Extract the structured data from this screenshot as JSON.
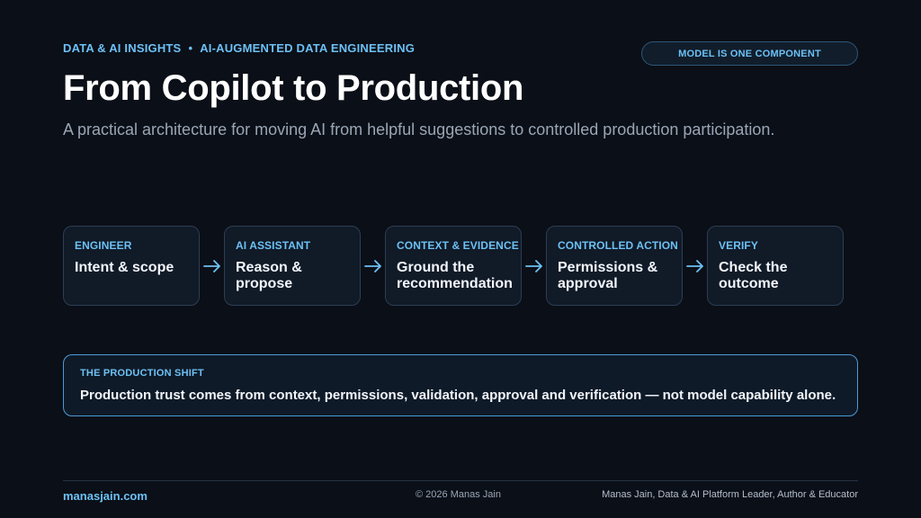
{
  "header": {
    "kicker_left": "DATA & AI INSIGHTS",
    "kicker_sep": "•",
    "kicker_right": "AI-AUGMENTED DATA ENGINEERING",
    "badge": "MODEL IS ONE COMPONENT",
    "title": "From Copilot to Production",
    "subtitle": "A practical architecture for moving AI from helpful suggestions to controlled production participation."
  },
  "flow": {
    "steps": [
      {
        "label": "ENGINEER",
        "text": "Intent & scope"
      },
      {
        "label": "AI ASSISTANT",
        "text": "Reason & propose"
      },
      {
        "label": "CONTEXT & EVIDENCE",
        "text": "Ground the recommendation"
      },
      {
        "label": "CONTROLLED ACTION",
        "text": "Permissions & approval"
      },
      {
        "label": "VERIFY",
        "text": "Check the outcome"
      }
    ],
    "arrow_icon": "arrow-right-icon"
  },
  "shift": {
    "label": "THE PRODUCTION SHIFT",
    "text": "Production trust comes from context, permissions, validation, approval and verification — not model capability alone."
  },
  "footer": {
    "website": "manasjain.com",
    "copyright": "© 2026 Manas Jain",
    "author": "Manas Jain, Data & AI Platform Leader, Author & Educator"
  },
  "colors": {
    "background": "#0b0f17",
    "accent": "#6cc1f5",
    "card": "#111a27",
    "card_border": "#2c3e55",
    "highlight_border": "#4a9bd6"
  }
}
